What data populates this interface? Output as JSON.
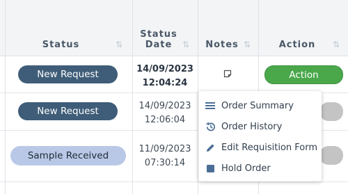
{
  "header": {
    "status": "Status",
    "status_date": "Status Date",
    "notes": "Notes",
    "action": "Action",
    "sort_glyph": "⇅"
  },
  "rows": [
    {
      "status": "New Request",
      "date": "14/09/2023",
      "time": "12:04:24",
      "bold": true
    },
    {
      "status": "New Request",
      "date": "14/09/2023",
      "time": "12:06:04",
      "bold": false
    },
    {
      "status": "Sample Received",
      "date": "11/09/2023",
      "time": "07:30:14",
      "bold": false
    }
  ],
  "action_button_label": "Action",
  "menu": {
    "items": [
      {
        "label": "Order Summary",
        "icon": "list-icon"
      },
      {
        "label": "Order History",
        "icon": "history-icon"
      },
      {
        "label": "Edit Requisition Form",
        "icon": "pencil-icon"
      },
      {
        "label": "Hold Order",
        "icon": "square-icon"
      }
    ]
  },
  "colors": {
    "status_new_request": "#3f5d78",
    "status_sample_received": "#b9c8e6",
    "action_green": "#4aa84b",
    "menu_icon": "#4b6e96"
  }
}
